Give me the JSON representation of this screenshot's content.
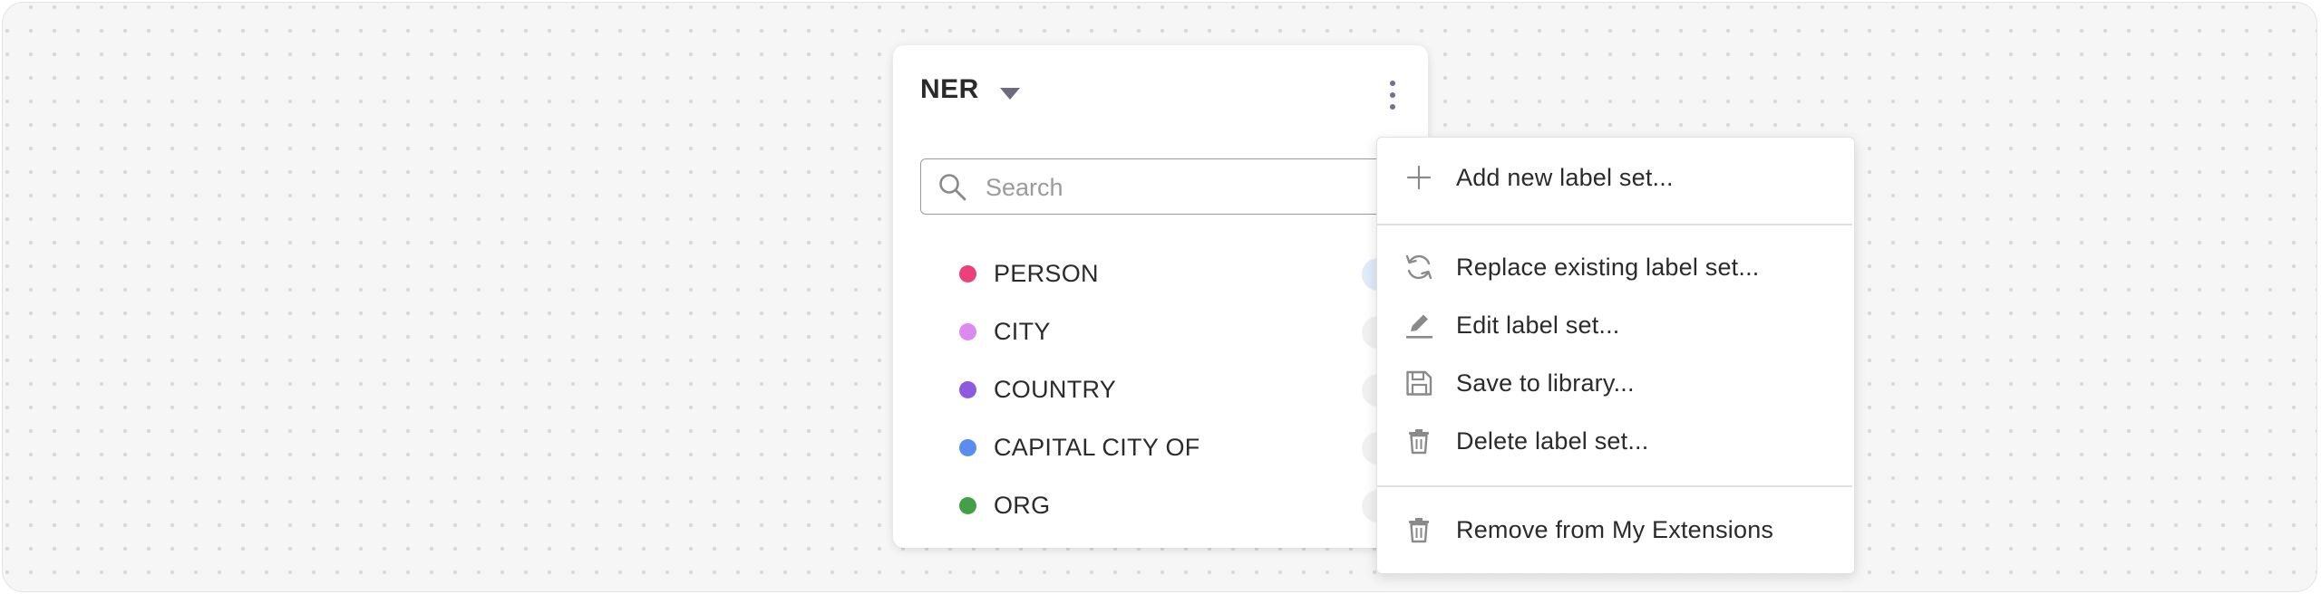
{
  "panel": {
    "title": "NER",
    "search_placeholder": "Search",
    "labels": [
      {
        "name": "PERSON",
        "color": "#ec407a"
      },
      {
        "name": "CITY",
        "color": "#dd8af0"
      },
      {
        "name": "COUNTRY",
        "color": "#8c5bdf"
      },
      {
        "name": "CAPITAL CITY OF",
        "color": "#5b8def"
      },
      {
        "name": "ORG",
        "color": "#43a047"
      }
    ]
  },
  "menu": {
    "items": [
      {
        "label": "Add new label set...",
        "icon": "plus-icon"
      },
      {
        "label": "Replace existing label set...",
        "icon": "replace-icon"
      },
      {
        "label": "Edit label set...",
        "icon": "pencil-icon"
      },
      {
        "label": "Save to library...",
        "icon": "save-icon"
      },
      {
        "label": "Delete label set...",
        "icon": "trash-icon"
      },
      {
        "label": "Remove from My Extensions",
        "icon": "trash-icon"
      }
    ]
  },
  "colors": {
    "icon_gray": "#8a8a8a",
    "kebab": "#70708a"
  }
}
